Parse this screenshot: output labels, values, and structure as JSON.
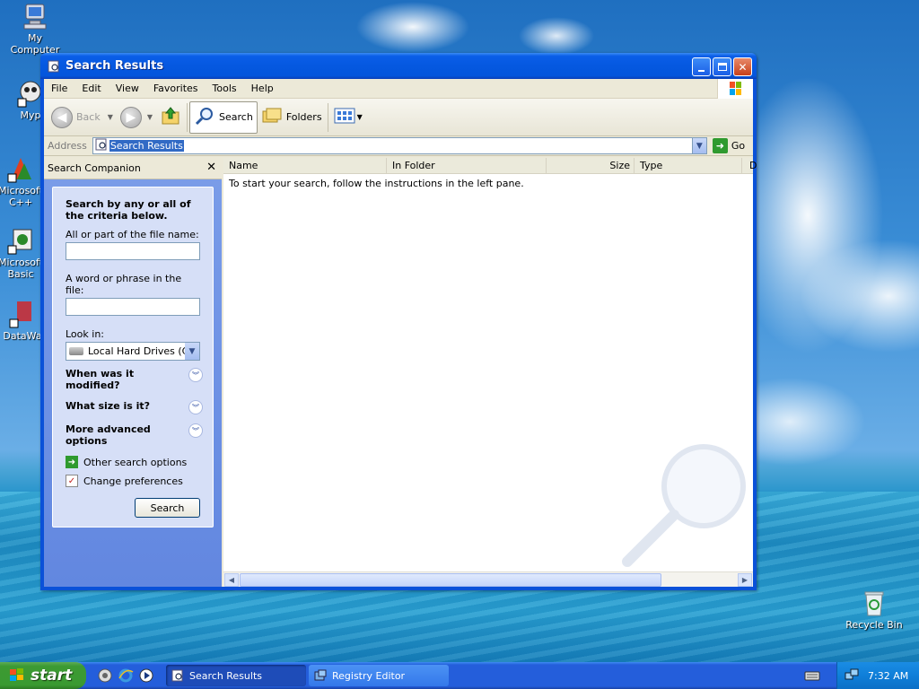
{
  "desktop": {
    "icons": [
      {
        "label": "My Computer"
      },
      {
        "label": "Myp"
      },
      {
        "label": "Microsoft C++"
      },
      {
        "label": "Microsoft Basic"
      },
      {
        "label": "DataWa"
      },
      {
        "label": "Recycle Bin"
      }
    ]
  },
  "window": {
    "title": "Search Results",
    "menu": [
      "File",
      "Edit",
      "View",
      "Favorites",
      "Tools",
      "Help"
    ],
    "toolbar": {
      "back": "Back",
      "search": "Search",
      "folders": "Folders"
    },
    "address": {
      "label": "Address",
      "value": "Search Results",
      "go": "Go"
    }
  },
  "companion": {
    "title": "Search Companion",
    "heading": "Search by any or all of the criteria below.",
    "filename_label": "All or part of the file name:",
    "filename_value": "",
    "phrase_label": "A word or phrase in the file:",
    "phrase_value": "",
    "lookin_label": "Look in:",
    "lookin_value": "Local Hard Drives (C:)",
    "expanders": [
      "When was it modified?",
      "What size is it?",
      "More advanced options"
    ],
    "links": [
      "Other search options",
      "Change preferences"
    ],
    "search_button": "Search"
  },
  "results": {
    "columns": [
      "Name",
      "In Folder",
      "Size",
      "Type",
      "D"
    ],
    "message": "To start your search, follow the instructions in the left pane."
  },
  "taskbar": {
    "start": "start",
    "tasks": [
      {
        "label": "Search Results",
        "active": true
      },
      {
        "label": "Registry Editor",
        "active": false
      }
    ],
    "clock": "7:32 AM"
  },
  "colors": {
    "titlebar": "#0558e0",
    "taskbar": "#245edb",
    "start": "#3a9a31",
    "address_selection": "#316ac5"
  }
}
